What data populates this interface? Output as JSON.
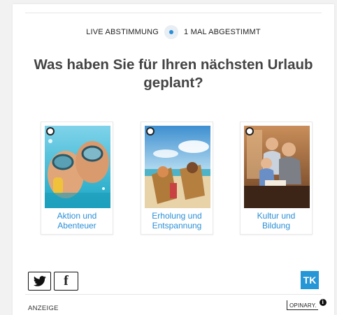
{
  "status": {
    "live_label": "LIVE ABSTIMMUNG",
    "votes_label": "1 MAL ABGESTIMMT"
  },
  "question": "Was haben Sie für Ihren nächsten Urlaub geplant?",
  "options": [
    {
      "label_line1": "Aktion und",
      "label_line2": "Abenteuer",
      "image": "snorkeling-photo"
    },
    {
      "label_line1": "Erholung und",
      "label_line2": "Entspannung",
      "image": "beach-chairs-photo"
    },
    {
      "label_line1": "Kultur und",
      "label_line2": "Bildung",
      "image": "family-reading-photo"
    }
  ],
  "social": {
    "twitter_icon": "twitter-icon",
    "facebook_icon": "facebook-icon",
    "facebook_glyph": "f"
  },
  "footer": {
    "ad_label": "ANZEIGE",
    "brand": "OPINARY.",
    "info_glyph": "i",
    "sponsor_logo_glyph": "TK"
  },
  "colors": {
    "accent": "#2a8fd6",
    "sponsor": "#2596d6"
  }
}
